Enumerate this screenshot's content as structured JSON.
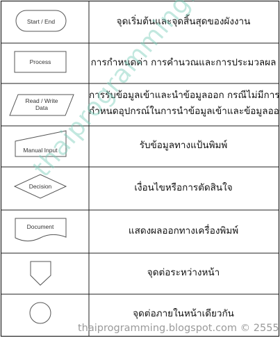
{
  "table": {
    "rows": [
      {
        "symbol": "terminator",
        "symbol_label": "Start / End",
        "description_lines": [
          "จุดเริ่มต้นและจุดสิ้นสุดของผังงาน"
        ]
      },
      {
        "symbol": "process",
        "symbol_label": "Process",
        "description_lines": [
          "การกำหนดค่า การคำนวณและการประมวลผล"
        ]
      },
      {
        "symbol": "data",
        "symbol_label_lines": [
          "Read / Write",
          "Data"
        ],
        "description_lines": [
          "การรับข้อมูลเข้าและนำข้อมูลออก กรณีไม่มีการ",
          "กำหนดอุปกรณ์ในการนำข้อมูลเข้าและข้อมูลออกนั้"
        ]
      },
      {
        "symbol": "manual-input",
        "symbol_label": "Manual Input",
        "description_lines": [
          "รับข้อมูลทางแป้นพิมพ์"
        ]
      },
      {
        "symbol": "decision",
        "symbol_label": "Decision",
        "description_lines": [
          "เงื่อนไขหรือการตัดสินใจ"
        ]
      },
      {
        "symbol": "document",
        "symbol_label": "Document",
        "description_lines": [
          "แสดงผลออกทางเครื่องพิมพ์"
        ]
      },
      {
        "symbol": "off-page-connector",
        "symbol_label": "",
        "description_lines": [
          "จุดต่อระหว่างหน้า"
        ]
      },
      {
        "symbol": "on-page-connector",
        "symbol_label": "",
        "description_lines": [
          "จุดต่อภายในหน้าเดียวกัน"
        ]
      }
    ]
  },
  "watermark": "thaiprogramming.blogspot.com",
  "footer": "thaiprogramming.blogspot.com © 2555",
  "colors": {
    "border": "#222222",
    "watermark": "#78cdb9",
    "footer_text": "#9a9a9a"
  }
}
